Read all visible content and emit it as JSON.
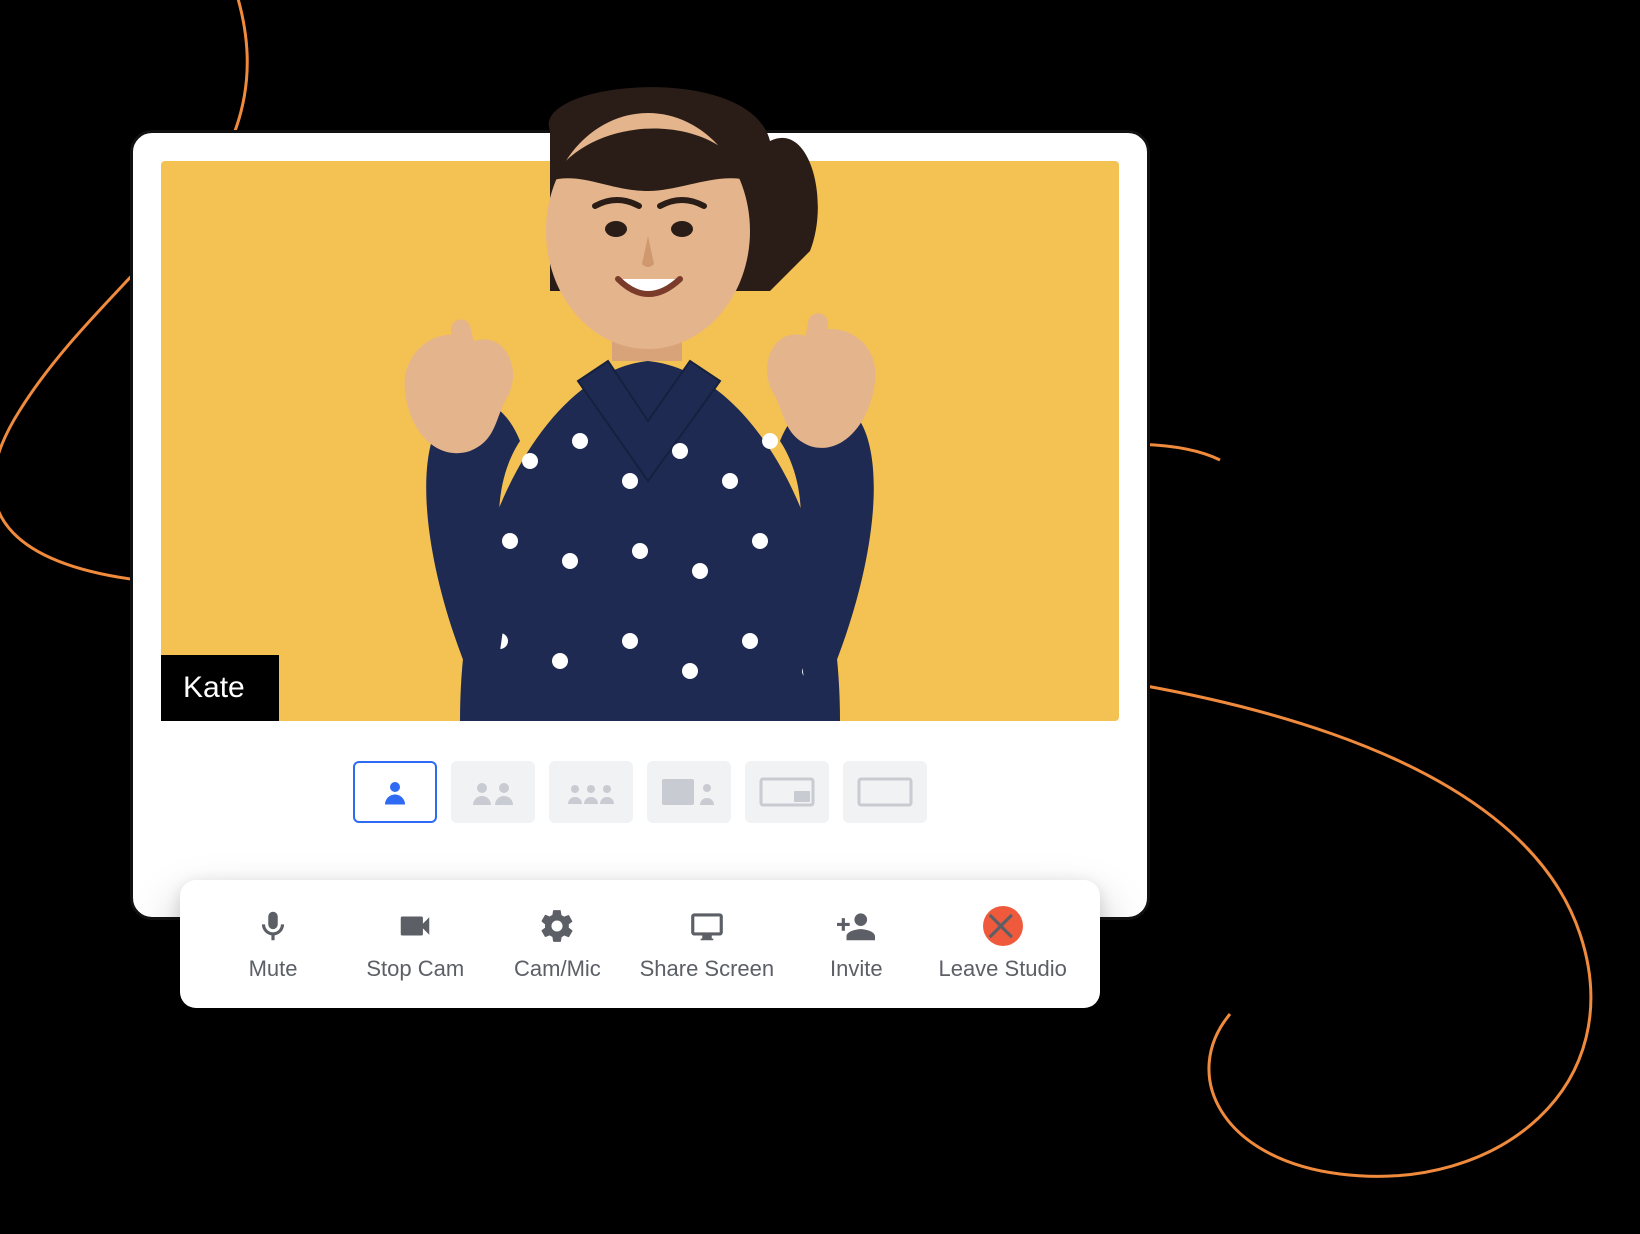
{
  "participant": {
    "name": "Kate"
  },
  "layouts": {
    "selected": 0,
    "options": [
      "single",
      "two-up",
      "three-up",
      "main-plus-side",
      "pip",
      "blank"
    ]
  },
  "toolbar": {
    "mute": {
      "label": "Mute",
      "icon": "microphone-icon"
    },
    "cam": {
      "label": "Stop Cam",
      "icon": "video-camera-icon"
    },
    "device": {
      "label": "Cam/Mic",
      "icon": "gear-icon"
    },
    "share": {
      "label": "Share Screen",
      "icon": "monitor-icon"
    },
    "invite": {
      "label": "Invite",
      "icon": "add-person-icon"
    },
    "leave": {
      "label": "Leave Studio",
      "icon": "close-icon"
    }
  },
  "colors": {
    "accent": "#2e6af3",
    "video_bg": "#f4c253",
    "danger": "#ef5a3c",
    "swirl": "#f08a3c"
  }
}
